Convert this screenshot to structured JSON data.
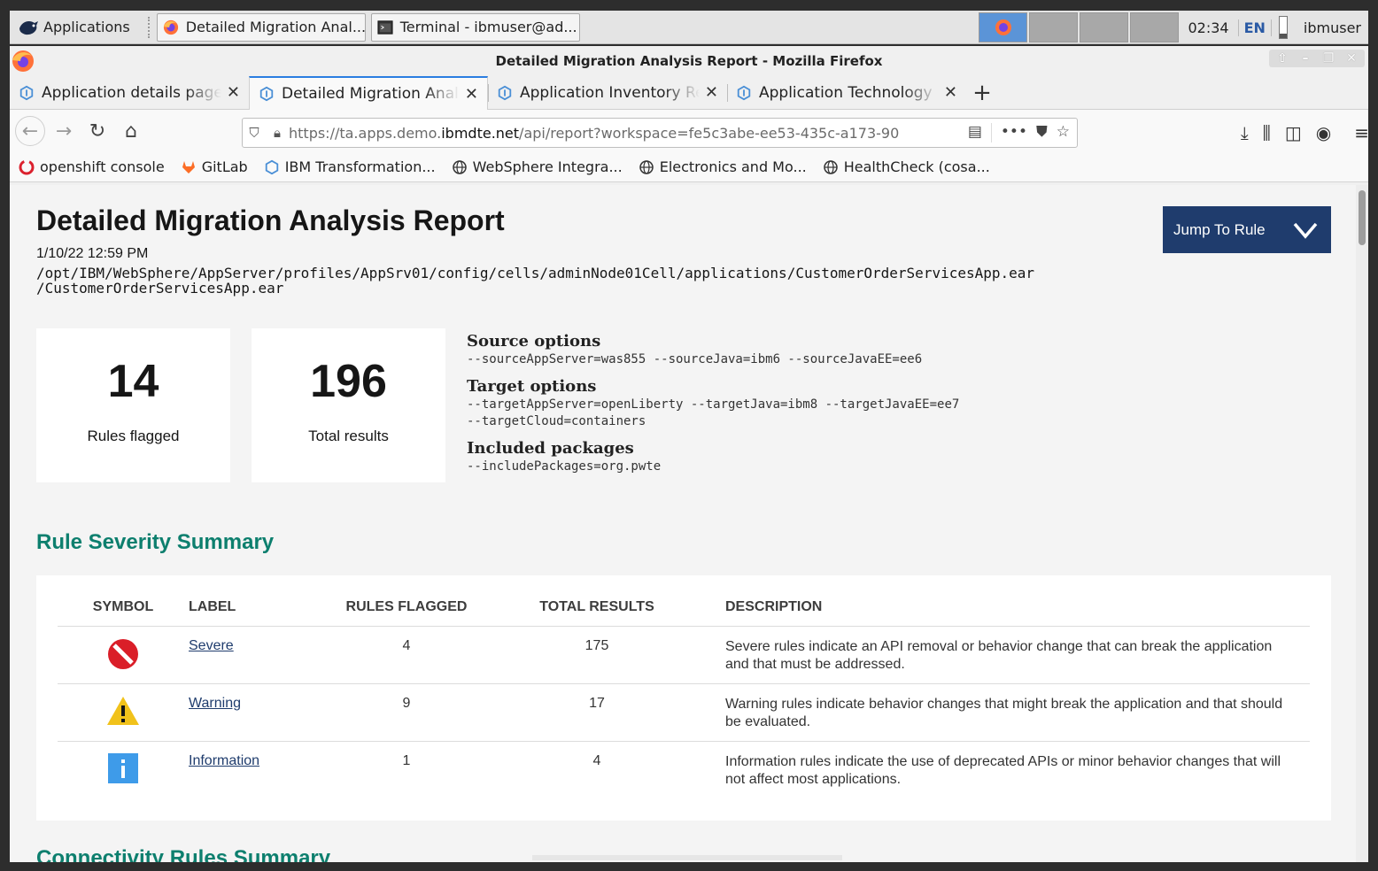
{
  "taskbar": {
    "apps_label": "Applications",
    "tasks": [
      {
        "label": "Detailed Migration Anal..."
      },
      {
        "label": "Terminal - ibmuser@ad..."
      }
    ],
    "clock": "02:34",
    "lang": "EN",
    "user": "ibmuser"
  },
  "window": {
    "title": "Detailed Migration Analysis Report - Mozilla Firefox"
  },
  "tabs": [
    {
      "title": "Application details page",
      "active": false
    },
    {
      "title": "Detailed Migration Analysis Report",
      "active": true
    },
    {
      "title": "Application Inventory Report",
      "active": false
    },
    {
      "title": "Application Technology Evaluation",
      "active": false
    }
  ],
  "urlbar": {
    "prefix": "https://ta.apps.demo.",
    "domain": "ibmdte.net",
    "path": "/api/report?workspace=fe5c3abe-ee53-435c-a173-90"
  },
  "bookmarks": [
    {
      "label": "openshift console",
      "icon": "openshift-icon"
    },
    {
      "label": "GitLab",
      "icon": "gitlab-icon"
    },
    {
      "label": "IBM Transformation...",
      "icon": "ibm-ta-icon"
    },
    {
      "label": "WebSphere Integra...",
      "icon": "globe-icon"
    },
    {
      "label": "Electronics and Mo...",
      "icon": "globe-icon"
    },
    {
      "label": "HealthCheck (cosa...",
      "icon": "globe-icon"
    }
  ],
  "report": {
    "title": "Detailed Migration Analysis Report",
    "date": "1/10/22 12:59 PM",
    "path_line1": "/opt/IBM/WebSphere/AppServer/profiles/AppSrv01/config/cells/adminNode01Cell/applications/CustomerOrderServicesApp.ear",
    "path_line2": "/CustomerOrderServicesApp.ear",
    "jump_label": "Jump To Rule",
    "stats": [
      {
        "value": "14",
        "label": "Rules flagged"
      },
      {
        "value": "196",
        "label": "Total results"
      }
    ],
    "options": {
      "source_title": "Source options",
      "source_value": "--sourceAppServer=was855 --sourceJava=ibm6 --sourceJavaEE=ee6",
      "target_title": "Target options",
      "target_value_1": "--targetAppServer=openLiberty --targetJava=ibm8 --targetJavaEE=ee7",
      "target_value_2": "--targetCloud=containers",
      "packages_title": "Included packages",
      "packages_value": "--includePackages=org.pwte"
    },
    "severity": {
      "heading": "Rule Severity Summary",
      "columns": [
        "Symbol",
        "Label",
        "Rules flagged",
        "Total results",
        "Description"
      ],
      "rows": [
        {
          "icon": "severe-icon",
          "label": "Severe",
          "rules_flagged": "4",
          "total_results": "175",
          "description": "Severe rules indicate an API removal or behavior change that can break the application and that must be addressed."
        },
        {
          "icon": "warning-icon",
          "label": "Warning",
          "rules_flagged": "9",
          "total_results": "17",
          "description": "Warning rules indicate behavior changes that might break the application and that should be evaluated."
        },
        {
          "icon": "information-icon",
          "label": "Information",
          "rules_flagged": "1",
          "total_results": "4",
          "description": "Information rules indicate the use of deprecated APIs or minor behavior changes that will not affect most applications."
        }
      ]
    },
    "next_heading": "Connectivity Rules Summary"
  },
  "colors": {
    "accent_heading": "#0d7f6e",
    "button": "#1f3c6d",
    "severe": "#da1e28",
    "warning": "#f1c21b",
    "info": "#3e9be9"
  }
}
